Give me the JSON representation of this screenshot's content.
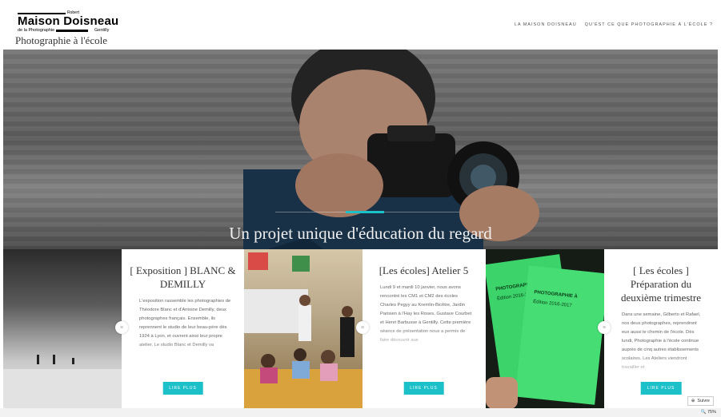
{
  "header": {
    "logo_top": "Robert",
    "logo_main": "Maison Doisneau",
    "logo_sub": "de la Photographie",
    "logo_city": "Gentilly",
    "site_title": "Photographie à l'école",
    "nav": [
      "LA MAISON DOISNEAU",
      "QU'EST CE QUE PHOTOGRAPHIE À L'ÉCOLE ?"
    ]
  },
  "hero": {
    "tagline": "Un projet unique d'éducation du regard",
    "accent_color": "#1cc0c9"
  },
  "posts": [
    {
      "title": "[ Exposition ] BLANC & DEMILLY",
      "excerpt": "L'exposition rassemble les photographies de Théodore Blanc et d'Antoine Demilly, deux photographes français. Ensemble, ils reprennent le studio de leur beau-père dès 1924 à Lyon, et ouvrent ainsi leur propre atelier. Le studio Blanc et Demilly va",
      "button": "LIRE PLUS"
    },
    {
      "title": "[Les écoles] Atelier 5",
      "excerpt": "Lundi 9 et mardi 10 janvier, nous avons rencontré les CM1 et CM2 des écoles Charles Pegyy au Kremlin-Bicêtre, Jardin Parisien à l'Hay les Roses, Gustave Courbet et Henri Barbusse à Gentilly. Cette première séance de présentation nous a permis de faire découvrir aux",
      "button": "LIRE PLUS"
    },
    {
      "title": "[ Les écoles ] Préparation du deuxième trimestre",
      "excerpt": "Dans une semaine, Gilberto et Rafael, nos deux photographes, reprendront eux aussi le chemin de l'école. Dès lundi, Photographie à l'école continue auprès de cinq autres établissements scolaires. Les Ateliers viendront travailler et",
      "button": "LIRE PLUS",
      "image_text": [
        "PHOTOGRAPHIE À L'ÉC",
        "Édition 2016-2017",
        "PHOTOGRAPHIE À",
        "Édition 2016-2017"
      ]
    }
  ],
  "widgets": {
    "follow": "Suivre",
    "zoom": "75%"
  }
}
